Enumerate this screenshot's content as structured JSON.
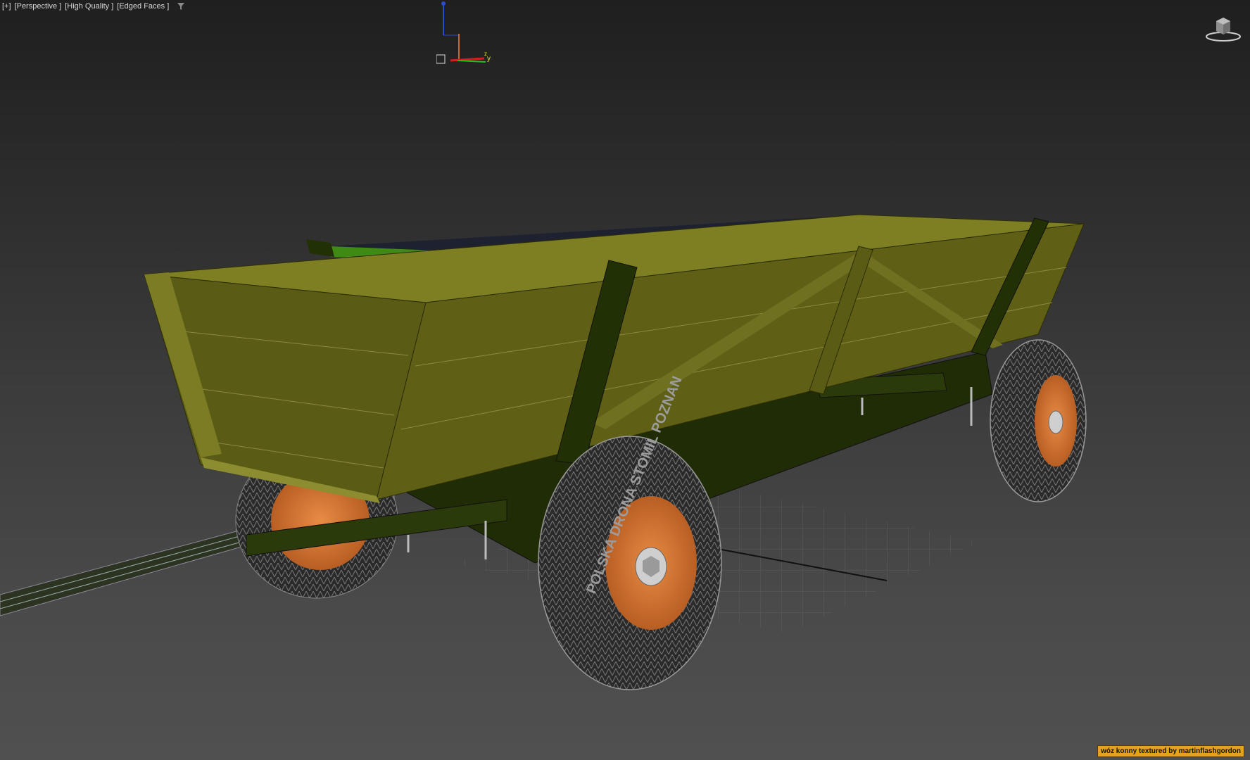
{
  "viewport": {
    "labels": [
      "[+]",
      "[Perspective ]",
      "[High Quality ]",
      "[Edged Faces ]"
    ],
    "filter_icon": "funnel-icon",
    "gizmo_axis_y": "y",
    "gizmo_axis_z": "z"
  },
  "watermark": {
    "text": "wóz konny textured by martinflashgordon"
  },
  "colors": {
    "background_top": "#1f1f1f",
    "background_bottom": "#505050",
    "wagon_body": "#6b6d1a",
    "wagon_frame": "#2b3a0a",
    "floor_green": "#3a7d12",
    "wheel_rim": "#d47a35",
    "tire": "#2d2d2d",
    "watermark_bg": "#e4a31a"
  },
  "tire_text": "POLSKA DRONA STOMIL POZNAN"
}
